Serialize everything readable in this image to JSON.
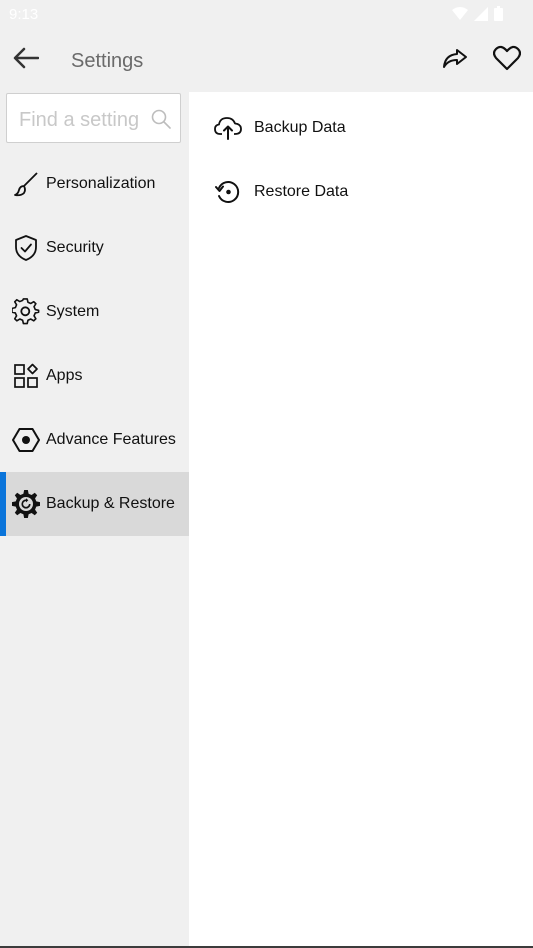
{
  "status_bar": {
    "time": "9:13"
  },
  "app_bar": {
    "title": "Settings"
  },
  "search": {
    "placeholder": "Find a setting"
  },
  "sidebar": {
    "items": [
      {
        "label": "Personalization",
        "icon": "brush-icon"
      },
      {
        "label": "Security",
        "icon": "shield-icon"
      },
      {
        "label": "System",
        "icon": "gear-icon"
      },
      {
        "label": "Apps",
        "icon": "apps-icon"
      },
      {
        "label": "Advance Features",
        "icon": "hexagon-icon"
      },
      {
        "label": "Backup & Restore",
        "icon": "backup-gear-icon",
        "active": true
      }
    ]
  },
  "content": {
    "items": [
      {
        "label": "Backup Data",
        "icon": "cloud-upload-icon"
      },
      {
        "label": "Restore Data",
        "icon": "restore-icon"
      }
    ]
  },
  "colors": {
    "accent": "#0a74da",
    "background": "#f0f0f0",
    "active_item": "#d9d9d9"
  }
}
